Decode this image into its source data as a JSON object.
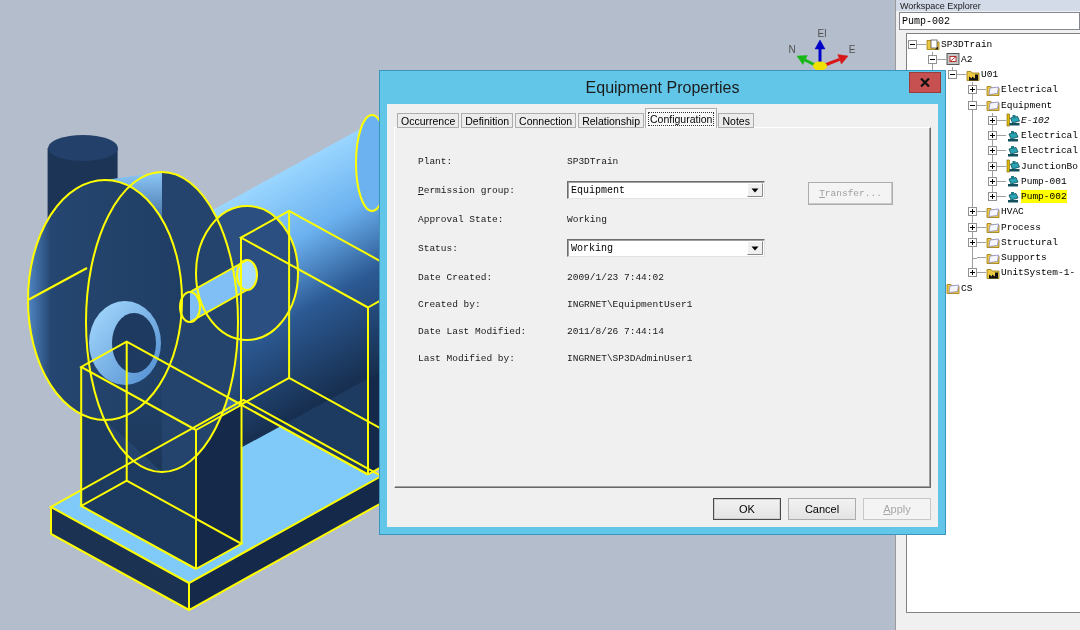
{
  "viewport": {
    "compass": [
      {
        "kind": "up",
        "label": "El",
        "color": "#0000c8"
      },
      {
        "kind": "left",
        "label": "N",
        "color": "#18b818"
      },
      {
        "kind": "right",
        "label": "E",
        "color": "#d81818"
      }
    ]
  },
  "explorer": {
    "title": "Workspace Explorer",
    "field_value": "Pump-002",
    "tree": [
      {
        "label": "SP3DTrain",
        "kind": "root",
        "expanded": true,
        "selected": false,
        "italic": false,
        "children": [
          {
            "label": "A2",
            "kind": "area",
            "expanded": true,
            "selected": false,
            "italic": false,
            "children": [
              {
                "label": "U01",
                "kind": "unit",
                "expanded": true,
                "selected": false,
                "italic": false,
                "children": [
                  {
                    "label": "Electrical",
                    "kind": "system",
                    "expanded": false,
                    "selected": false,
                    "italic": false
                  },
                  {
                    "label": "Equipment",
                    "kind": "system",
                    "expanded": true,
                    "selected": false,
                    "italic": false,
                    "children": [
                      {
                        "label": "E-102",
                        "kind": "assembly",
                        "expanded": false,
                        "selected": false,
                        "italic": true
                      },
                      {
                        "label": "Electrical",
                        "kind": "equipment",
                        "expanded": false,
                        "selected": false,
                        "italic": false
                      },
                      {
                        "label": "Electrical",
                        "kind": "equipment",
                        "expanded": false,
                        "selected": false,
                        "italic": false
                      },
                      {
                        "label": "JunctionBo",
                        "kind": "assembly",
                        "expanded": false,
                        "selected": false,
                        "italic": false
                      },
                      {
                        "label": "Pump-001",
                        "kind": "equipment",
                        "expanded": false,
                        "selected": false,
                        "italic": false
                      },
                      {
                        "label": "Pump-002",
                        "kind": "equipment",
                        "expanded": false,
                        "selected": true,
                        "italic": false
                      }
                    ]
                  },
                  {
                    "label": "HVAC",
                    "kind": "system",
                    "expanded": false,
                    "selected": false,
                    "italic": false
                  },
                  {
                    "label": "Process",
                    "kind": "system",
                    "expanded": false,
                    "selected": false,
                    "italic": false
                  },
                  {
                    "label": "Structural",
                    "kind": "system",
                    "expanded": false,
                    "selected": false,
                    "italic": false
                  },
                  {
                    "label": "Supports",
                    "kind": "system",
                    "selected": false,
                    "italic": false
                  },
                  {
                    "label": "UnitSystem-1-",
                    "kind": "unit",
                    "expanded": false,
                    "selected": false,
                    "italic": false
                  }
                ]
              }
            ]
          },
          {
            "label": "CS",
            "kind": "system",
            "selected": false,
            "italic": false
          }
        ]
      }
    ]
  },
  "dialog": {
    "title": "Equipment Properties",
    "tabs": [
      {
        "label": "Occurrence",
        "selected": false
      },
      {
        "label": "Definition",
        "selected": false
      },
      {
        "label": "Connection",
        "selected": false
      },
      {
        "label": "Relationship",
        "selected": false
      },
      {
        "label": "Configuration",
        "selected": true
      },
      {
        "label": "Notes",
        "selected": false
      }
    ],
    "fields": [
      {
        "kind": "text",
        "label": "Plant:",
        "value": "SP3DTrain",
        "mnemonic": false
      },
      {
        "kind": "combo",
        "label": "Permission group:",
        "value": "Equipment",
        "mnemonic": true,
        "button": {
          "label": "Transfer...",
          "disabled": true,
          "mnemonic": true
        }
      },
      {
        "kind": "text",
        "label": "Approval State:",
        "value": "Working",
        "mnemonic": false
      },
      {
        "kind": "combo",
        "label": "Status:",
        "value": "Working",
        "mnemonic": false
      },
      {
        "kind": "text",
        "label": "Date Created:",
        "value": "2009/1/23 7:44:02",
        "mnemonic": false
      },
      {
        "kind": "text",
        "label": "Created by:",
        "value": "INGRNET\\EquipmentUser1",
        "mnemonic": false
      },
      {
        "kind": "text",
        "label": "Date Last Modified:",
        "value": "2011/8/26 7:44:14",
        "mnemonic": false
      },
      {
        "kind": "text",
        "label": "Last Modified by:",
        "value": "INGRNET\\SP3DAdminUser1",
        "mnemonic": false
      }
    ],
    "buttons": [
      {
        "label": "OK",
        "default": true,
        "disabled": false,
        "mnemonic": false
      },
      {
        "label": "Cancel",
        "default": false,
        "disabled": false,
        "mnemonic": false
      },
      {
        "label": "Apply",
        "default": false,
        "disabled": true,
        "mnemonic": true
      }
    ]
  }
}
